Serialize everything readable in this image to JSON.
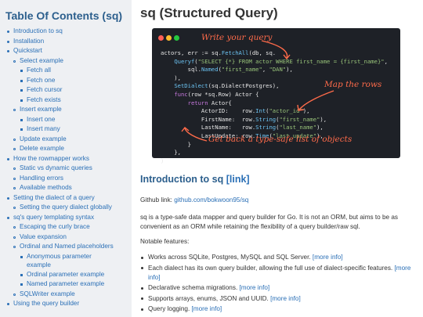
{
  "sidebar": {
    "title": "Table Of Contents (sq)",
    "items": [
      {
        "label": "Introduction to sq",
        "level": 0
      },
      {
        "label": "Installation",
        "level": 0
      },
      {
        "label": "Quickstart",
        "level": 0
      },
      {
        "label": "Select example",
        "level": 1
      },
      {
        "label": "Fetch all",
        "level": 2
      },
      {
        "label": "Fetch one",
        "level": 2
      },
      {
        "label": "Fetch cursor",
        "level": 2
      },
      {
        "label": "Fetch exists",
        "level": 2
      },
      {
        "label": "Insert example",
        "level": 1
      },
      {
        "label": "Insert one",
        "level": 2
      },
      {
        "label": "Insert many",
        "level": 2
      },
      {
        "label": "Update example",
        "level": 1
      },
      {
        "label": "Delete example",
        "level": 1
      },
      {
        "label": "How the rowmapper works",
        "level": 0
      },
      {
        "label": "Static vs dynamic queries",
        "level": 1
      },
      {
        "label": "Handling errors",
        "level": 1
      },
      {
        "label": "Available methods",
        "level": 1
      },
      {
        "label": "Setting the dialect of a query",
        "level": 0
      },
      {
        "label": "Setting the query dialect globally",
        "level": 1
      },
      {
        "label": "sq's query templating syntax",
        "level": 0
      },
      {
        "label": "Escaping the curly brace",
        "level": 1
      },
      {
        "label": "Value expansion",
        "level": 1
      },
      {
        "label": "Ordinal and Named placeholders",
        "level": 1
      },
      {
        "label": "Anonymous parameter example",
        "level": 2
      },
      {
        "label": "Ordinal parameter example",
        "level": 2
      },
      {
        "label": "Named parameter example",
        "level": 2
      },
      {
        "label": "SQLWriter example",
        "level": 1
      },
      {
        "label": "Using the query builder",
        "level": 0
      }
    ]
  },
  "main": {
    "title": "sq (Structured Query)",
    "code_lines": [
      [
        {
          "t": "actors, err := sq.",
          "c": "id"
        },
        {
          "t": "FetchAll",
          "c": "fn"
        },
        {
          "t": "(db, sq.",
          "c": "id"
        }
      ],
      [
        {
          "t": "    ",
          "c": "id"
        },
        {
          "t": "Queryf",
          "c": "fn"
        },
        {
          "t": "(",
          "c": "id"
        },
        {
          "t": "\"SELECT {*} FROM actor WHERE first_name = {first_name}\"",
          "c": "str"
        },
        {
          "t": ",",
          "c": "id"
        }
      ],
      [
        {
          "t": "        sql.",
          "c": "id"
        },
        {
          "t": "Named",
          "c": "fn"
        },
        {
          "t": "(",
          "c": "id"
        },
        {
          "t": "\"first_name\"",
          "c": "str"
        },
        {
          "t": ", ",
          "c": "id"
        },
        {
          "t": "\"DAN\"",
          "c": "str"
        },
        {
          "t": "),",
          "c": "id"
        }
      ],
      [
        {
          "t": "    ),",
          "c": "id"
        }
      ],
      [
        {
          "t": "    ",
          "c": "id"
        },
        {
          "t": "SetDialect",
          "c": "fn"
        },
        {
          "t": "(sq.DialectPostgres),",
          "c": "id"
        }
      ],
      [
        {
          "t": "    ",
          "c": "id"
        },
        {
          "t": "func",
          "c": "kw"
        },
        {
          "t": "(row *sq.Row) Actor {",
          "c": "id"
        }
      ],
      [
        {
          "t": "        ",
          "c": "id"
        },
        {
          "t": "return",
          "c": "kw"
        },
        {
          "t": " Actor{",
          "c": "id"
        }
      ],
      [
        {
          "t": "            ActorID:    row.",
          "c": "id"
        },
        {
          "t": "Int",
          "c": "fn"
        },
        {
          "t": "(",
          "c": "id"
        },
        {
          "t": "\"actor_id\"",
          "c": "str"
        },
        {
          "t": "),",
          "c": "id"
        }
      ],
      [
        {
          "t": "            FirstName:  row.",
          "c": "id"
        },
        {
          "t": "String",
          "c": "fn"
        },
        {
          "t": "(",
          "c": "id"
        },
        {
          "t": "\"first_name\"",
          "c": "str"
        },
        {
          "t": "),",
          "c": "id"
        }
      ],
      [
        {
          "t": "            LastName:   row.",
          "c": "id"
        },
        {
          "t": "String",
          "c": "fn"
        },
        {
          "t": "(",
          "c": "id"
        },
        {
          "t": "\"last_name\"",
          "c": "str"
        },
        {
          "t": "),",
          "c": "id"
        }
      ],
      [
        {
          "t": "            LastUpdate: row.",
          "c": "id"
        },
        {
          "t": "Time",
          "c": "fn"
        },
        {
          "t": "(",
          "c": "id"
        },
        {
          "t": "\"last_update\"",
          "c": "str"
        },
        {
          "t": "),",
          "c": "id"
        }
      ],
      [
        {
          "t": "        }",
          "c": "id"
        }
      ],
      [
        {
          "t": "    },",
          "c": "id"
        }
      ],
      [
        {
          "t": ")",
          "c": "id"
        }
      ]
    ],
    "notes": {
      "write_query": "Write your query",
      "map_rows": "Map the rows",
      "typesafe": "Get back a type-safe list of objects"
    },
    "section": {
      "title": "Introduction to sq",
      "link": "[link]",
      "github_label": "Github link: ",
      "github_url": "github.com/bokwoon95/sq",
      "description": "sq is a type-safe data mapper and query builder for Go. It is not an ORM, but aims to be as convenient as an ORM while retaining the flexibility of a query builder/raw sql.",
      "notable": "Notable features:",
      "features": [
        {
          "text": "Works across SQLite, Postgres, MySQL and SQL Server. ",
          "more": "[more info]"
        },
        {
          "text": "Each dialect has its own query builder, allowing the full use of dialect-specific features. ",
          "more": "[more info]"
        },
        {
          "text": "Declarative schema migrations. ",
          "more": "[more info]"
        },
        {
          "text": "Supports arrays, enums, JSON and UUID. ",
          "more": "[more info]"
        },
        {
          "text": "Query logging. ",
          "more": "[more info]"
        }
      ]
    }
  }
}
